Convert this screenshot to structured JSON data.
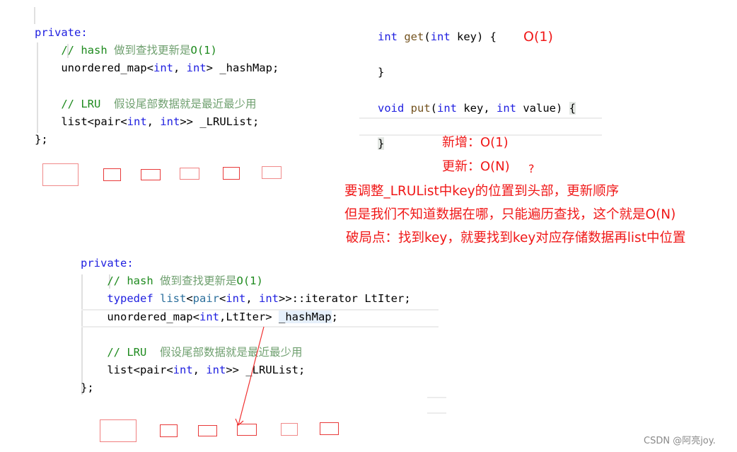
{
  "top_code": [
    [
      {
        "t": "private:",
        "c": "kw"
      }
    ],
    [
      {
        "t": "    "
      },
      {
        "t": "// hash ",
        "c": "cm"
      },
      {
        "t": "做到查找更新是",
        "c": "cmz"
      },
      {
        "t": "O(1)",
        "c": "cm"
      }
    ],
    [
      {
        "t": "    unordered_map<"
      },
      {
        "t": "int",
        "c": "kw"
      },
      {
        "t": ", "
      },
      {
        "t": "int",
        "c": "kw"
      },
      {
        "t": "> _hashMap;"
      }
    ],
    [
      {
        "t": ""
      }
    ],
    [
      {
        "t": "    "
      },
      {
        "t": "// LRU  ",
        "c": "cm"
      },
      {
        "t": "假设尾部数据就是最近最少用",
        "c": "cmz"
      }
    ],
    [
      {
        "t": "    list<pair<"
      },
      {
        "t": "int",
        "c": "kw"
      },
      {
        "t": ", "
      },
      {
        "t": "int",
        "c": "kw"
      },
      {
        "t": ">> _LRUList;"
      }
    ],
    [
      {
        "t": "};"
      }
    ]
  ],
  "right_code": [
    [
      {
        "t": "int",
        "c": "kw"
      },
      {
        "t": " "
      },
      {
        "t": "get",
        "c": "fn"
      },
      {
        "t": "("
      },
      {
        "t": "int",
        "c": "kw"
      },
      {
        "t": " key) {"
      }
    ],
    [
      {
        "t": ""
      }
    ],
    [
      {
        "t": "}"
      }
    ],
    [
      {
        "t": ""
      }
    ],
    [
      {
        "t": "void",
        "c": "kw"
      },
      {
        "t": " "
      },
      {
        "t": "put",
        "c": "fn"
      },
      {
        "t": "("
      },
      {
        "t": "int",
        "c": "kw"
      },
      {
        "t": " key, "
      },
      {
        "t": "int",
        "c": "kw"
      },
      {
        "t": " value) "
      },
      {
        "t": "{",
        "c": "brace"
      }
    ],
    [
      {
        "t": ""
      }
    ],
    [
      {
        "t": "}",
        "c": "brace"
      }
    ]
  ],
  "bottom_code": [
    [
      {
        "t": "private:",
        "c": "kw"
      }
    ],
    [
      {
        "t": "    "
      },
      {
        "t": "// hash ",
        "c": "cm"
      },
      {
        "t": "做到查找更新是",
        "c": "cmz"
      },
      {
        "t": "O(1)",
        "c": "cm"
      }
    ],
    [
      {
        "t": "    "
      },
      {
        "t": "typedef",
        "c": "kw"
      },
      {
        "t": " "
      },
      {
        "t": "list",
        "c": "ty"
      },
      {
        "t": "<"
      },
      {
        "t": "pair",
        "c": "ty"
      },
      {
        "t": "<"
      },
      {
        "t": "int",
        "c": "kw"
      },
      {
        "t": ", "
      },
      {
        "t": "int",
        "c": "kw"
      },
      {
        "t": ">>::iterator LtIter;"
      }
    ],
    [
      {
        "t": "    unordered_map<"
      },
      {
        "t": "int",
        "c": "kw"
      },
      {
        "t": ",LtIter> "
      },
      {
        "t": "_hashMap",
        "c": "sel"
      },
      {
        "t": ";"
      }
    ],
    [
      {
        "t": ""
      }
    ],
    [
      {
        "t": "    "
      },
      {
        "t": "// LRU  ",
        "c": "cm"
      },
      {
        "t": "假设尾部数据就是最近最少用",
        "c": "cmz"
      }
    ],
    [
      {
        "t": "    list<pair<"
      },
      {
        "t": "int",
        "c": "kw"
      },
      {
        "t": ", "
      },
      {
        "t": "int",
        "c": "kw"
      },
      {
        "t": ">> _LRUList;"
      }
    ],
    [
      {
        "t": "};"
      }
    ]
  ],
  "annotations": {
    "get_complexity": "O(1)",
    "insert": "新增：O(1)",
    "update": "更新：O(N)",
    "question": "?",
    "line1": "要调整_LRUList中key的位置到头部，更新顺序",
    "line2": "但是我们不知道数据在哪，只能遍历查找，这个就是O(N)",
    "line3": "破局点：找到key，就要找到key对应存储数据再list中位置"
  },
  "watermark": "CSDN @阿亮joy.",
  "colors": {
    "annotation": "#f01818",
    "keyword": "#2020e0",
    "comment": "#1e8a1e"
  }
}
